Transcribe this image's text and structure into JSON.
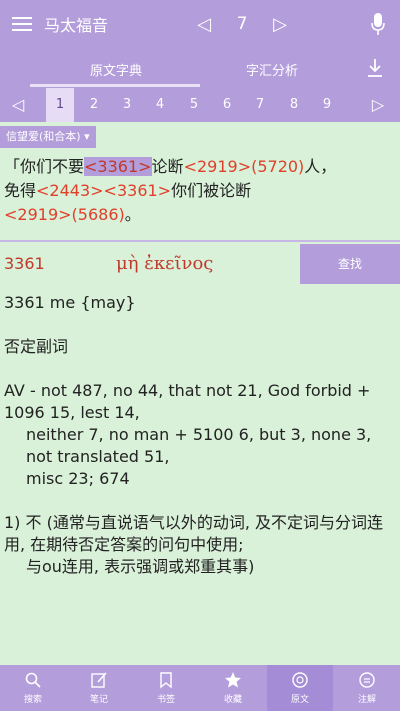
{
  "header": {
    "title": "马太福音",
    "chapter": "7",
    "prev_arrow": "◁",
    "next_arrow": "▷"
  },
  "tabs": {
    "active": "原文字典",
    "other": "字汇分析"
  },
  "verse_nav": {
    "prev": "◁",
    "next": "▷",
    "verses": [
      "1",
      "2",
      "3",
      "4",
      "5",
      "6",
      "7",
      "8",
      "9"
    ],
    "selected": "1"
  },
  "version_selector": "信望爱(和合本) ▾",
  "verse": {
    "parts": [
      {
        "t": "「你们不要",
        "type": "text"
      },
      {
        "t": "<3361>",
        "type": "ref-hl"
      },
      {
        "t": "论断",
        "type": "text"
      },
      {
        "t": "<2919>(5720)",
        "type": "ref"
      },
      {
        "t": "人，",
        "type": "text"
      },
      {
        "t": "免得",
        "type": "text"
      },
      {
        "t": "<2443><3361>",
        "type": "ref"
      },
      {
        "t": "你们被论断",
        "type": "text"
      },
      {
        "t": "<2919>(5686)",
        "type": "ref"
      },
      {
        "t": "。",
        "type": "text"
      }
    ]
  },
  "lexicon": {
    "number": "3361",
    "greek": "μὴ ἐκεῖνος",
    "search_label": "查找",
    "line1": "3361 me {may}",
    "line2": "否定副词",
    "av_line1": "AV - not 487, no 44, that not 21, God forbid + 1096 15, lest 14,",
    "av_line2": "neither 7, no man + 5100 6, but 3, none 3, not translated 51,",
    "av_line3": "misc 23; 674",
    "def1": "1) 不 (通常与直说语气以外的动词, 及不定词与分词连用, 在期待否定答案的问句中使用;",
    "def2": "与ou连用, 表示强调或郑重其事)"
  },
  "bottom_nav": [
    {
      "label": "搜索",
      "icon": "search-icon"
    },
    {
      "label": "笔记",
      "icon": "note-icon"
    },
    {
      "label": "书签",
      "icon": "bookmark-icon"
    },
    {
      "label": "收藏",
      "icon": "star-icon"
    },
    {
      "label": "原文",
      "icon": "original-text-icon"
    },
    {
      "label": "注解",
      "icon": "annotation-icon"
    }
  ],
  "colors": {
    "accent": "#b39ddb",
    "background": "#d9f0d9",
    "reference": "#e0402a"
  }
}
